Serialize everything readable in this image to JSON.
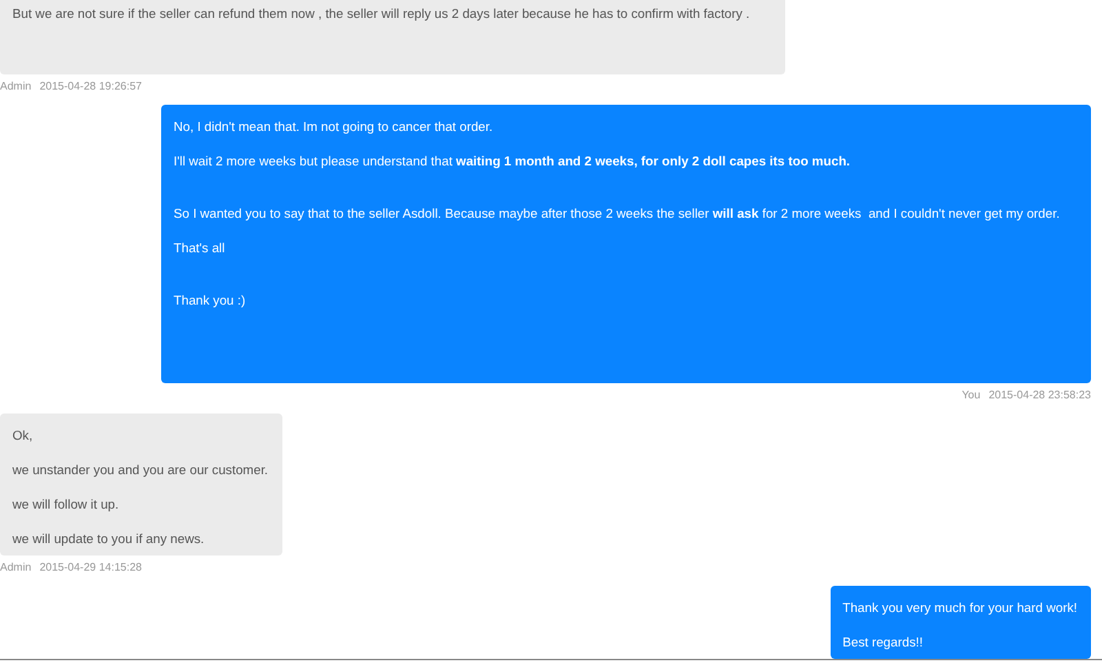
{
  "messages": [
    {
      "kind": "admin",
      "paragraphs": [
        {
          "text": "But we are not sure if the seller can refund them now , the seller will reply us 2 days later because he has to confirm with factory .",
          "spaced": false
        }
      ],
      "trailing_gap": true,
      "meta": {
        "author": "Admin",
        "time": "2015-04-28 19:26:57"
      }
    },
    {
      "kind": "you",
      "paragraphs": [
        {
          "text": "No, I didn't mean that. Im not going to cancer that order.",
          "spaced": false
        },
        {
          "text": "I'll wait 2 more weeks but please understand that **waiting 1 month and 2 weeks, for only 2 doll capes its too much.**",
          "spaced": false
        },
        {
          "text": "So I wanted you to say that to the seller Asdoll. Because maybe after those 2 weeks the seller **will ask** for 2 more weeks  and I couldn't never get my order.",
          "spaced": true
        },
        {
          "text": "That's all",
          "spaced": false
        },
        {
          "text": "Thank you :)",
          "spaced": true
        }
      ],
      "trailing_gap": true,
      "meta": {
        "author": "You",
        "time": "2015-04-28 23:58:23"
      }
    },
    {
      "kind": "admin",
      "paragraphs": [
        {
          "text": "Ok,",
          "spaced": false
        },
        {
          "text": "we unstander you and you are our customer.",
          "spaced": false
        },
        {
          "text": "we will follow it up.",
          "spaced": false
        },
        {
          "text": "we will update to you if any news.",
          "spaced": false
        }
      ],
      "trailing_gap": false,
      "meta": {
        "author": "Admin",
        "time": "2015-04-29 14:15:28"
      }
    },
    {
      "kind": "you",
      "paragraphs": [
        {
          "text": "Thank you very much for your hard work!",
          "spaced": false
        },
        {
          "text": "Best regards!!",
          "spaced": false
        }
      ],
      "trailing_gap": false
    }
  ]
}
